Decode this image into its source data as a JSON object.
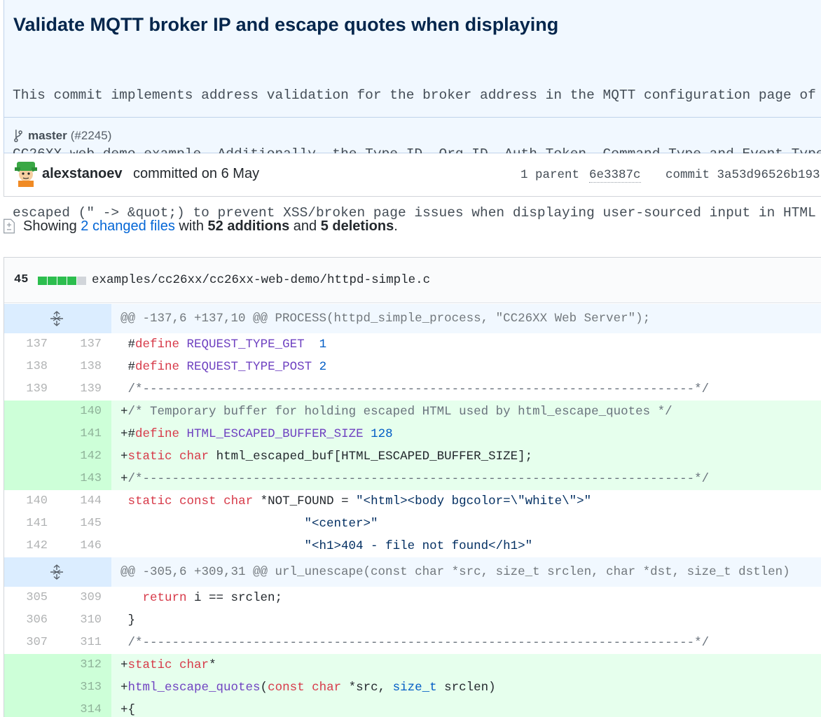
{
  "commit": {
    "title": "Validate MQTT broker IP and escape quotes when displaying",
    "description_lines": [
      "This commit implements address validation for the broker address in the MQTT configuration page of",
      "CC26XX web demo example. Additionally, the Type ID, Org ID, Auth Token, Command Type and Event Type",
      "escaped (\" -> &quot;) to prevent XSS/broken page issues when displaying user-sourced input in HTML"
    ],
    "branch": "master",
    "pr": "(#2245)",
    "author": "alexstanoev",
    "committed_text": "committed on 6 May",
    "parent_label": "1 parent",
    "parent_sha": "6e3387c",
    "commit_label": "commit 3a53d96526b193"
  },
  "summary": {
    "showing": "Showing",
    "changed_files": "2 changed files",
    "with": "with",
    "additions": "52 additions",
    "and": "and",
    "deletions": "5 deletions",
    "period": "."
  },
  "file": {
    "diffstat": "45",
    "diffstat_blocks": [
      "add",
      "add",
      "add",
      "add",
      "neutral"
    ],
    "path": "examples/cc26xx/cc26xx-web-demo/httpd-simple.c"
  },
  "diff_rows": [
    {
      "type": "hunk",
      "text": "@@ -137,6 +137,10 @@ PROCESS(httpd_simple_process, \"CC26XX Web Server\");"
    },
    {
      "type": "ctx",
      "old": "137",
      "new": "137",
      "tokens": [
        [
          "pl",
          " #"
        ],
        [
          "kw",
          "define"
        ],
        [
          "pl",
          " "
        ],
        [
          "fn",
          "REQUEST_TYPE_GET"
        ],
        [
          "pl",
          "  "
        ],
        [
          "nm",
          "1"
        ]
      ]
    },
    {
      "type": "ctx",
      "old": "138",
      "new": "138",
      "tokens": [
        [
          "pl",
          " #"
        ],
        [
          "kw",
          "define"
        ],
        [
          "pl",
          " "
        ],
        [
          "fn",
          "REQUEST_TYPE_POST"
        ],
        [
          "pl",
          " "
        ],
        [
          "nm",
          "2"
        ]
      ]
    },
    {
      "type": "ctx",
      "old": "139",
      "new": "139",
      "tokens": [
        [
          "cm",
          " /*---------------------------------------------------------------------------*/"
        ]
      ]
    },
    {
      "type": "add",
      "old": "",
      "new": "140",
      "tokens": [
        [
          "pl",
          "+"
        ],
        [
          "cm",
          "/* Temporary buffer for holding escaped HTML used by html_escape_quotes */"
        ]
      ]
    },
    {
      "type": "add",
      "old": "",
      "new": "141",
      "tokens": [
        [
          "pl",
          "+#"
        ],
        [
          "kw",
          "define"
        ],
        [
          "pl",
          " "
        ],
        [
          "fn",
          "HTML_ESCAPED_BUFFER_SIZE"
        ],
        [
          "pl",
          " "
        ],
        [
          "nm",
          "128"
        ]
      ]
    },
    {
      "type": "add",
      "old": "",
      "new": "142",
      "tokens": [
        [
          "pl",
          "+"
        ],
        [
          "kw",
          "static"
        ],
        [
          "pl",
          " "
        ],
        [
          "kw",
          "char"
        ],
        [
          "pl",
          " html_escaped_buf[HTML_ESCAPED_BUFFER_SIZE];"
        ]
      ]
    },
    {
      "type": "add",
      "old": "",
      "new": "143",
      "tokens": [
        [
          "pl",
          "+"
        ],
        [
          "cm",
          "/*---------------------------------------------------------------------------*/"
        ]
      ]
    },
    {
      "type": "ctx",
      "old": "140",
      "new": "144",
      "tokens": [
        [
          "pl",
          " "
        ],
        [
          "kw",
          "static"
        ],
        [
          "pl",
          " "
        ],
        [
          "kw",
          "const"
        ],
        [
          "pl",
          " "
        ],
        [
          "kw",
          "char"
        ],
        [
          "pl",
          " *NOT_FOUND = "
        ],
        [
          "str",
          "\"<html><body bgcolor=\\\"white\\\">\""
        ]
      ]
    },
    {
      "type": "ctx",
      "old": "141",
      "new": "145",
      "tokens": [
        [
          "pl",
          "                         "
        ],
        [
          "str",
          "\"<center>\""
        ]
      ]
    },
    {
      "type": "ctx",
      "old": "142",
      "new": "146",
      "tokens": [
        [
          "pl",
          "                         "
        ],
        [
          "str",
          "\"<h1>404 - file not found</h1>\""
        ]
      ]
    },
    {
      "type": "hunk",
      "text": "@@ -305,6 +309,31 @@ url_unescape(const char *src, size_t srclen, char *dst, size_t dstlen)"
    },
    {
      "type": "ctx",
      "old": "305",
      "new": "309",
      "tokens": [
        [
          "pl",
          "   "
        ],
        [
          "kw",
          "return"
        ],
        [
          "pl",
          " i == srclen;"
        ]
      ]
    },
    {
      "type": "ctx",
      "old": "306",
      "new": "310",
      "tokens": [
        [
          "pl",
          " }"
        ]
      ]
    },
    {
      "type": "ctx",
      "old": "307",
      "new": "311",
      "tokens": [
        [
          "cm",
          " /*---------------------------------------------------------------------------*/"
        ]
      ]
    },
    {
      "type": "add",
      "old": "",
      "new": "312",
      "tokens": [
        [
          "pl",
          "+"
        ],
        [
          "kw",
          "static"
        ],
        [
          "pl",
          " "
        ],
        [
          "kw",
          "char"
        ],
        [
          "pl",
          "*"
        ]
      ]
    },
    {
      "type": "add",
      "old": "",
      "new": "313",
      "tokens": [
        [
          "pl",
          "+"
        ],
        [
          "fn",
          "html_escape_quotes"
        ],
        [
          "pl",
          "("
        ],
        [
          "kw",
          "const"
        ],
        [
          "pl",
          " "
        ],
        [
          "kw",
          "char"
        ],
        [
          "pl",
          " *src, "
        ],
        [
          "nm",
          "size_t"
        ],
        [
          "pl",
          " srclen)"
        ]
      ]
    },
    {
      "type": "add",
      "old": "",
      "new": "314",
      "tokens": [
        [
          "pl",
          "+{"
        ]
      ]
    }
  ]
}
